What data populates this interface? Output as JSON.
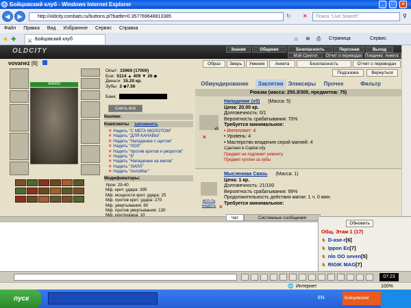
{
  "window": {
    "title": "Бойцовский клуб - Windows Internet Explorer"
  },
  "address": {
    "url": "http://oldcity.combats.ru/buttons.pl?battle=0.357769648813385",
    "search_placeholder": "Поиск \"Live Search\""
  },
  "menu": [
    "Файл",
    "Правка",
    "Вид",
    "Избранное",
    "Сервис",
    "Справка"
  ],
  "tab": {
    "label": "Бойцовский клуб"
  },
  "toolbar_right": {
    "page": "Страница",
    "service": "Сервис"
  },
  "game": {
    "logo": "OLDCITY",
    "topnav": [
      "Знания",
      "Общение",
      "Безопасность",
      "Персонаж",
      "Выход"
    ],
    "subnav": [
      "Мой Сриллл",
      "Отчет о переводах",
      "Поединки",
      "Анкета"
    ],
    "char": {
      "name": "vovanez",
      "level": "[6]",
      "hp": "404/404"
    },
    "stats": [
      {
        "label": "Опыт:",
        "value": "15969 (17000)"
      },
      {
        "label": "Бои:",
        "value": "5114 ▲ 409 ▼ 26 ◆"
      },
      {
        "label": "Деньги:",
        "value": "15.20 кр."
      },
      {
        "label": "Зубы:",
        "value": "2 ◆7.56"
      }
    ],
    "bank_label": "Банк:",
    "undress": "Снять всё",
    "buttons_label": "Кнопки:",
    "sets_label": "Комплекты",
    "remember": "запомнить",
    "sets": [
      "Надеть \"С МЕГА МОЛОТОМ\"",
      "Надеть \"ДЛЯ КАНАВЫ\"",
      "Надеть \"Нападение с щитом\"",
      "Надеть \"ЛОЛ\"",
      "Надеть \"против критов и уворотов\"",
      "Надеть \"6\"",
      "Надеть \"Нападение на магов\"",
      "Надеть \"ХИЛЛ\"",
      "Надеть \"АнтиМаг\""
    ],
    "mods_label": "Модификаторы:",
    "mods": [
      "Урон: 29-40",
      "Мф. крит. удара: 395",
      "Мф. мощности крит. удара: 25",
      "Мф. против крит. удара: 270",
      "Мф. увертывания: 80",
      "Мф. против увертывания: 130",
      "Мф. контрудара: 10"
    ],
    "rbuttons": [
      "Образ",
      "Зверь",
      "Умения",
      "Анкета",
      "Безопасность",
      "Отчет о переводах"
    ],
    "rbuttons2": [
      "Подсказка",
      "Вернуться"
    ],
    "itabs": [
      "Обмундирование",
      "Заклятия",
      "Эликсиры",
      "Прочее",
      "Фильтр"
    ],
    "backpack": "Рюкзак (масса: 250.3/305, предметов: 75)",
    "item1": {
      "name": "Нападение (x5)",
      "mass": "(Масса: 5)",
      "price": "Цена: 20.00 кр.",
      "dur": "Долговечность: 0/1",
      "prob": "Вероятность срабатывания: 70%",
      "req": "Требуется минимальное:",
      "reqs": [
        "• Интеллект: 4",
        "• Уровень: 4",
        "• Мастерство владения серой магией: 4"
      ],
      "made": "Сделано в Capital city",
      "note1": "Предмет не подлежит ремонту",
      "note2": "Предмет куплен за зубы",
      "count": "x5"
    },
    "item2": {
      "name": "Мысленная Связь",
      "mass": "(Масса: 1)",
      "price": "Цена: 1 кр.",
      "dur": "Долговечность: 21/100",
      "prob": "Вероятность срабатывания: 99%",
      "dura": "Продолжительность действия магии: 1 ч. 0 мин.",
      "req": "Требуется минимальное:",
      "use": "исп-ть надеть"
    },
    "chat_tabs": [
      "Чат",
      "Системные сообщения"
    ],
    "refresh": "Обновить",
    "room": "Общ. Этаж 1 (17)",
    "users": [
      {
        "name": "D-ase-r",
        "level": "[6]"
      },
      {
        "name": "Ippon Ec",
        "level": "[7]"
      },
      {
        "name": "nlo OO seven",
        "level": "[5]"
      },
      {
        "name": "RIGIK MAG",
        "level": "[7]"
      }
    ],
    "clock": "07:23"
  },
  "status": {
    "zone": "Интернет",
    "zoom": "100%"
  },
  "taskbar": {
    "start": "пуск",
    "lang": "EN",
    "win": "Бойцовский клуб..."
  },
  "colors": {
    "title_blue": "#0a58e0",
    "page_bg": "#e6e0c8",
    "link_blue": "#0030a0",
    "tab_active": "#c4d4ec"
  }
}
